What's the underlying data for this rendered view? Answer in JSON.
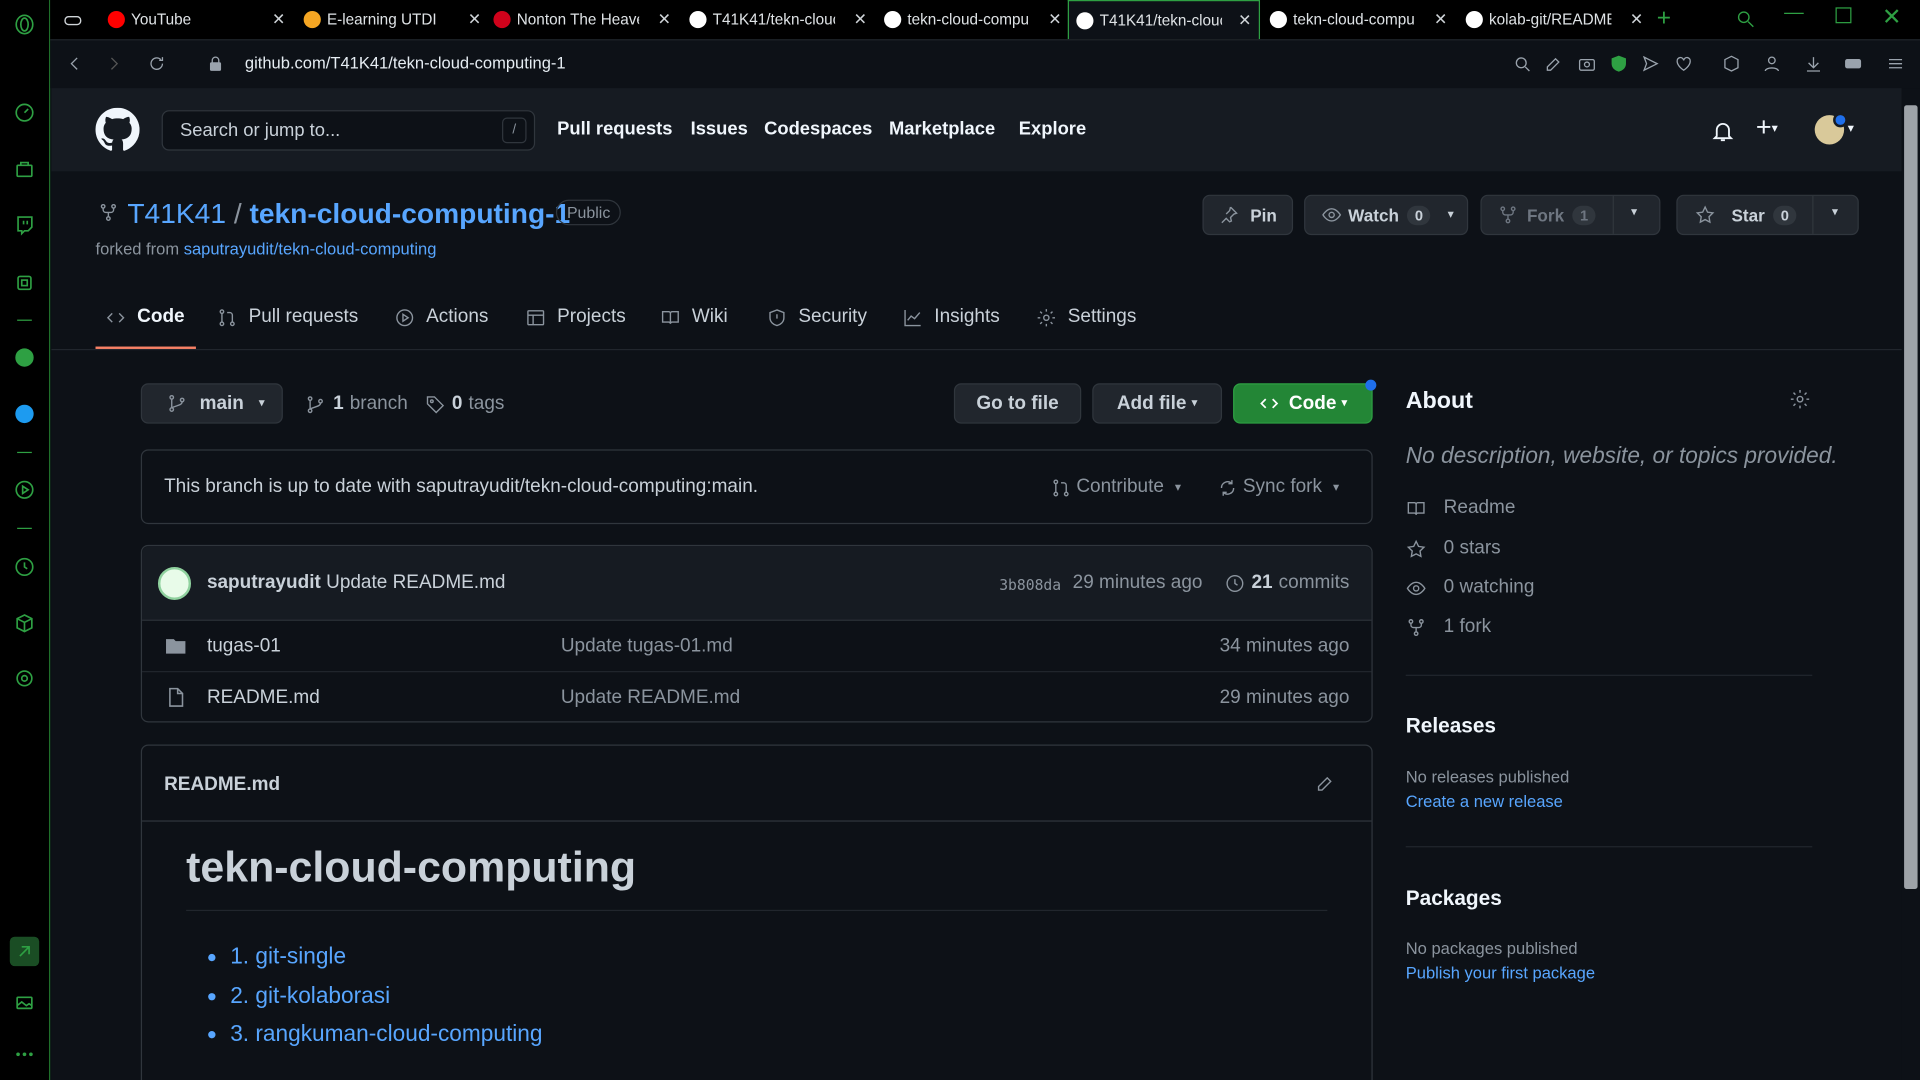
{
  "browser": {
    "tabs": [
      {
        "title": "YouTube",
        "color": "#ff0000"
      },
      {
        "title": "E-learning UTDI",
        "color": "#f5a623"
      },
      {
        "title": "Nonton The Heave",
        "color": "#d0021b"
      },
      {
        "title": "T41K41/tekn-clouc",
        "color": "#ffffff"
      },
      {
        "title": "tekn-cloud-compu",
        "color": "#ffffff"
      },
      {
        "title": "T41K41/tekn-clouc",
        "color": "#ffffff",
        "active": true
      },
      {
        "title": "tekn-cloud-compu",
        "color": "#ffffff"
      },
      {
        "title": "kolab-git/README",
        "color": "#ffffff"
      }
    ],
    "url": "github.com/T41K41/tekn-cloud-computing-1"
  },
  "header": {
    "search_placeholder": "Search or jump to...",
    "slash": "/",
    "nav": [
      "Pull requests",
      "Issues",
      "Codespaces",
      "Marketplace",
      "Explore"
    ]
  },
  "repo": {
    "owner": "T41K41",
    "separator": "/",
    "name": "tekn-cloud-computing-1",
    "visibility": "Public",
    "forked_prefix": "forked from ",
    "forked_from": "saputrayudit/tekn-cloud-computing",
    "pin_label": "Pin",
    "watch_label": "Watch",
    "watch_count": "0",
    "fork_label": "Fork",
    "fork_count": "1",
    "star_label": "Star",
    "star_count": "0"
  },
  "tabs": [
    "Code",
    "Pull requests",
    "Actions",
    "Projects",
    "Wiki",
    "Security",
    "Insights",
    "Settings"
  ],
  "branch": {
    "name": "main",
    "branch_count": "1",
    "branch_label": "branch",
    "tag_count": "0",
    "tag_label": "tags",
    "goto_file": "Go to file",
    "add_file": "Add file",
    "code": "Code"
  },
  "sync": {
    "message": "This branch is up to date with saputrayudit/tekn-cloud-computing:main.",
    "contribute": "Contribute",
    "sync_fork": "Sync fork"
  },
  "commit": {
    "author": "saputrayudit",
    "message": "Update README.md",
    "sha": "3b808da",
    "time": "29 minutes ago",
    "count": "21",
    "count_label": "commits"
  },
  "files": [
    {
      "type": "folder",
      "name": "tugas-01",
      "message": "Update tugas-01.md",
      "time": "34 minutes ago"
    },
    {
      "type": "file",
      "name": "README.md",
      "message": "Update README.md",
      "time": "29 minutes ago"
    }
  ],
  "readme": {
    "filename": "README.md",
    "title": "tekn-cloud-computing",
    "items": [
      "1. git-single",
      "2. git-kolaborasi",
      "3. rangkuman-cloud-computing"
    ]
  },
  "about": {
    "heading": "About",
    "description": "No description, website, or topics provided.",
    "readme": "Readme",
    "stars": "0 stars",
    "watching": "0 watching",
    "forks": "1 fork",
    "releases_heading": "Releases",
    "releases_text": "No releases published",
    "releases_link": "Create a new release",
    "packages_heading": "Packages",
    "packages_text": "No packages published",
    "packages_link": "Publish your first package"
  }
}
